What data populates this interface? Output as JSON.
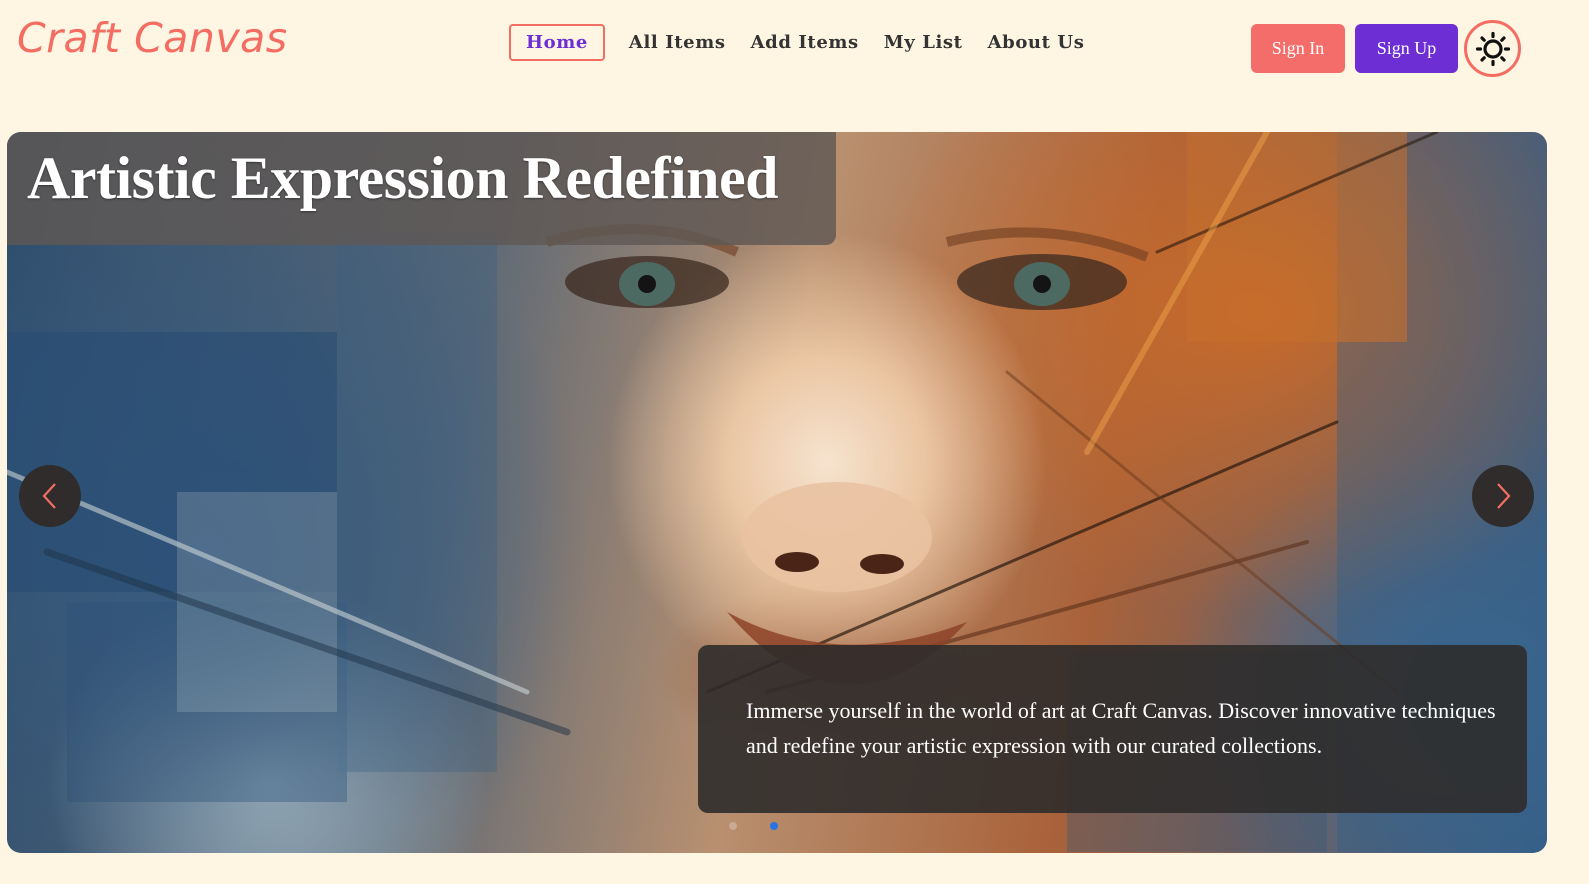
{
  "header": {
    "logo": "Craft Canvas",
    "nav": [
      {
        "label": "Home",
        "active": true
      },
      {
        "label": "All Items",
        "active": false
      },
      {
        "label": "Add Items",
        "active": false
      },
      {
        "label": "My List",
        "active": false
      },
      {
        "label": "About Us",
        "active": false
      }
    ],
    "sign_in": "Sign In",
    "sign_up": "Sign Up",
    "theme_icon": "sun-icon"
  },
  "hero": {
    "title": "Artistic Expression Redefined",
    "description": "Immerse yourself in the world of art at Craft Canvas. Discover innovative techniques and redefine your artistic expression with our curated collections.",
    "prev_icon": "chevron-left-icon",
    "next_icon": "chevron-right-icon",
    "slide_count": 2,
    "active_slide": 2
  },
  "colors": {
    "background": "#fef5e3",
    "accent_coral": "#f46d63",
    "accent_purple": "#6d2fd4",
    "dot_active": "#2773e6"
  }
}
